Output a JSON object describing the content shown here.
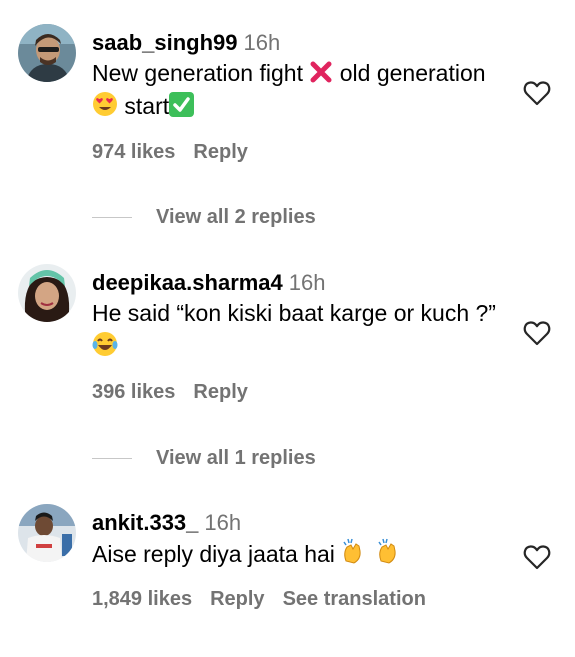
{
  "comments": [
    {
      "username": "saab_singh99",
      "time": "16h",
      "text_part1": "New generation fight",
      "emoji1": "cross-mark-icon",
      "text_part2": " old generation ",
      "emoji2": "heart-eyes-icon",
      "text_part3": " start",
      "emoji3": "check-mark-icon",
      "likes": "974 likes",
      "reply": "Reply",
      "replies_label": "View all 2 replies"
    },
    {
      "username": "deepikaa.sharma4",
      "time": "16h",
      "text_part1": "He said “kon kiski baat karge or kuch ?”",
      "emoji1": "laughing-tears-icon",
      "likes": "396 likes",
      "reply": "Reply",
      "replies_label": "View all 1 replies"
    },
    {
      "username": "ankit.333_",
      "time": "16h",
      "text_part1": "Aise reply diya jaata hai ",
      "emoji1": "clapping-hands-icon",
      "likes": "1,849 likes",
      "reply": "Reply",
      "translation": "See translation"
    }
  ]
}
